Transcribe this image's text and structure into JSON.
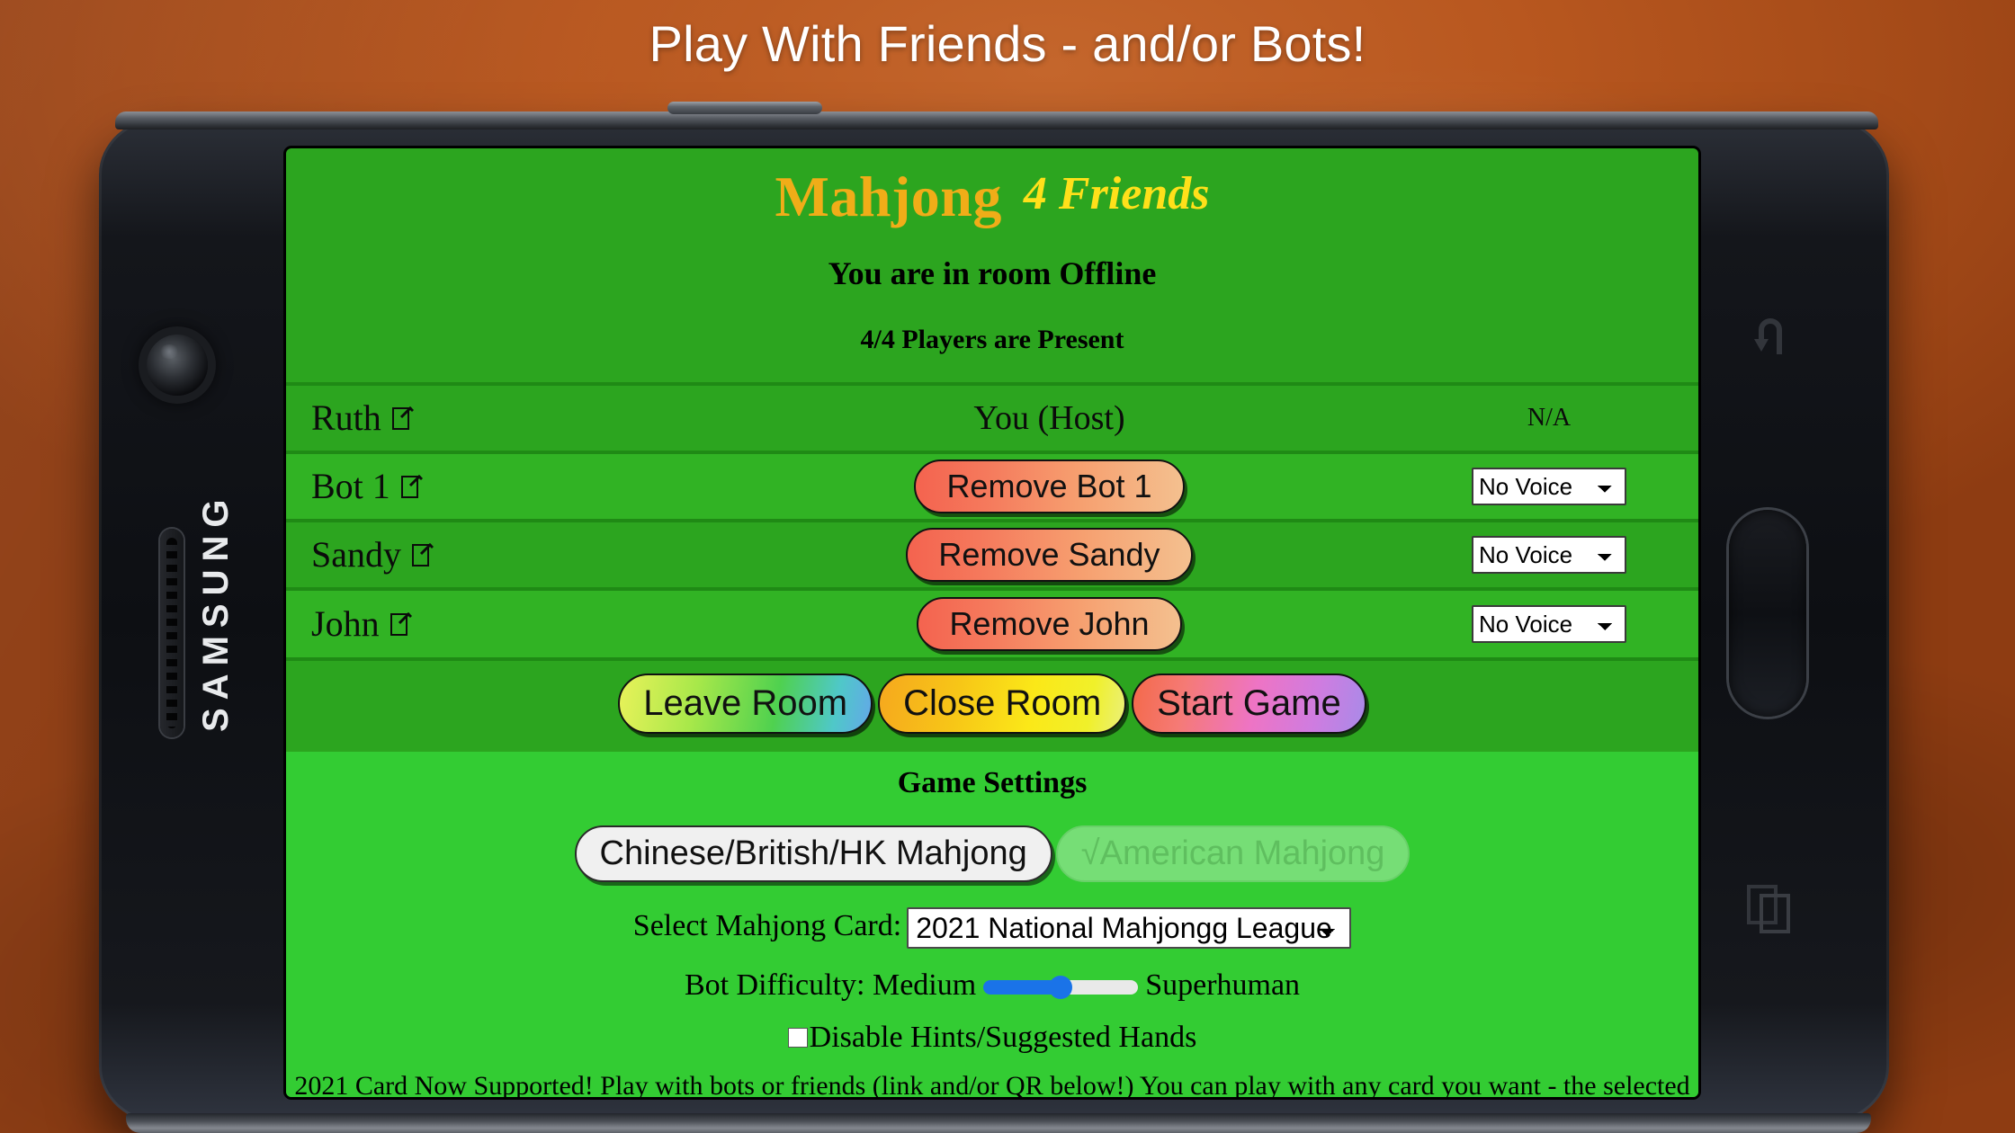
{
  "banner": {
    "title": "Play With Friends - and/or Bots!"
  },
  "device": {
    "brand": "SAMSUNG",
    "nav": {
      "back_icon": "back-arrow-icon",
      "home_icon": "home-button",
      "recents_icon": "recents-icon"
    },
    "camera_icon": "camera-lens-icon",
    "speaker_icon": "speaker-grille-icon"
  },
  "app": {
    "title_main": "Mahjong",
    "title_sub": "4 Friends",
    "room_line": "You are in room Offline",
    "players_line": "4/4 Players are Present"
  },
  "players": [
    {
      "name": "Ruth",
      "edit_icon": "edit-pencil-icon",
      "action": "You (Host)",
      "action_type": "text",
      "voice": "N/A",
      "voice_type": "text"
    },
    {
      "name": "Bot 1",
      "edit_icon": "edit-pencil-icon",
      "action": "Remove Bot 1",
      "action_type": "button",
      "voice": "No Voice",
      "voice_type": "select"
    },
    {
      "name": "Sandy",
      "edit_icon": "edit-pencil-icon",
      "action": "Remove Sandy",
      "action_type": "button",
      "voice": "No Voice",
      "voice_type": "select"
    },
    {
      "name": "John",
      "edit_icon": "edit-pencil-icon",
      "action": "Remove John",
      "action_type": "button",
      "voice": "No Voice",
      "voice_type": "select"
    }
  ],
  "voice_options": [
    "No Voice"
  ],
  "actions": {
    "leave": "Leave Room",
    "close": "Close Room",
    "start": "Start Game"
  },
  "settings": {
    "title": "Game Settings",
    "mode_chinese": "Chinese/British/HK Mahjong",
    "mode_american": "√American Mahjong",
    "card_label": "Select Mahjong Card:",
    "card_value": "2021 National Mahjongg League",
    "card_options": [
      "2021 National Mahjongg League"
    ],
    "difficulty_label": "Bot Difficulty: Medium",
    "difficulty_max_label": "Superhuman",
    "difficulty_percent": 50,
    "hints_label": "Disable Hints/Suggested Hands",
    "hints_checked": false
  },
  "footer": {
    "note": "2021 Card Now Supported! Play with bots or friends (link and/or QR below!) You can play with any card you want - the selected"
  },
  "colors": {
    "screen_green": "#2ca51f",
    "settings_green": "#33cc33",
    "title_gold": "#f0ad18",
    "title_yellow": "#ffe01a",
    "slider_blue": "#1a73e8",
    "background_orange": "#b8551f"
  }
}
